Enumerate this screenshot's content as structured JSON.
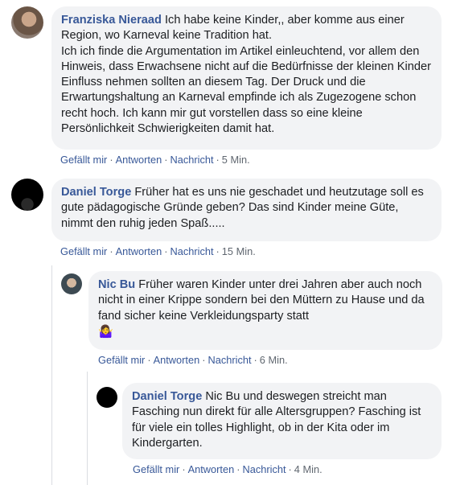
{
  "comments": [
    {
      "author": "Franziska Nieraad",
      "text": "Ich habe keine Kinder,, aber komme aus einer Region, wo Karneval keine Tradition hat.",
      "text2": "Ich ich finde die Argumentation im Artikel einleuchtend, vor allem den Hinweis, dass Erwachsene nicht auf die Bedürfnisse der kleinen Kinder Einfluss nehmen sollten an diesem Tag. Der Druck und die Erwartungshaltung an Karneval empfinde ich als Zugezogene schon recht hoch. Ich kann mir gut vorstellen dass so eine kleine Persönlichkeit Schwierigkeiten damit hat.",
      "like": "Gefällt mir",
      "reply": "Antworten",
      "message": "Nachricht",
      "time": "5 Min."
    },
    {
      "author": "Daniel Torge",
      "text": "Früher hat es uns nie geschadet und heutzutage soll es gute pädagogische Gründe geben? Das sind Kinder meine Güte, nimmt den ruhig jeden Spaß.....",
      "like": "Gefällt mir",
      "reply": "Antworten",
      "message": "Nachricht",
      "time": "15 Min."
    },
    {
      "author": "Nic Bu",
      "text": "Früher waren Kinder unter drei Jahren aber auch noch nicht in einer Krippe sondern bei den Müttern zu Hause und da fand sicher keine Verkleidungsparty statt",
      "emoji": "🤷‍♀️",
      "like": "Gefällt mir",
      "reply": "Antworten",
      "message": "Nachricht",
      "time": "6 Min."
    },
    {
      "author": "Daniel Torge",
      "text": "Nic Bu und deswegen streicht man Fasching nun direkt für alle Altersgruppen? Fasching ist für viele ein tolles Highlight, ob in der Kita oder im Kindergarten.",
      "like": "Gefällt mir",
      "reply": "Antworten",
      "message": "Nachricht",
      "time": "4 Min."
    }
  ],
  "colors": {
    "author": "#385898",
    "bubble": "#f2f3f5",
    "meta": "#606770"
  },
  "separator": "·"
}
